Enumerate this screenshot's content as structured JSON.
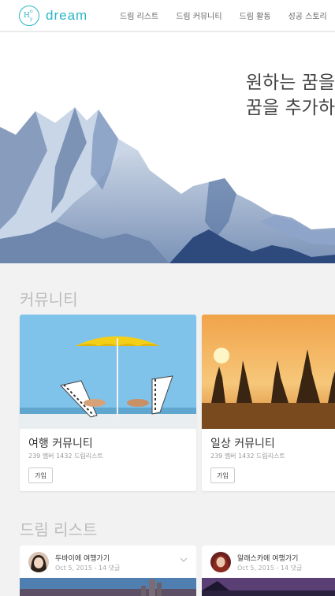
{
  "header": {
    "logo_text": "dream",
    "nav": [
      "드림 리스트",
      "드림 커뮤니티",
      "드림 활동",
      "성공 스토리"
    ]
  },
  "hero": {
    "line1": "원하는 꿈을",
    "line2": "꿈을 추가하"
  },
  "community": {
    "title": "커뮤니티",
    "cards": [
      {
        "title": "여행 커뮤니티",
        "meta": "239 멤버 1432 드림리스트",
        "button": "가입"
      },
      {
        "title": "일상 커뮤니티",
        "meta": "239 멤버 1432 드림리스트",
        "button": "가입"
      }
    ]
  },
  "dreamlist": {
    "title": "드림 리스트",
    "items": [
      {
        "title": "두바이에 여행가기",
        "meta": "Oct 5, 2015 - 14 댓글"
      },
      {
        "title": "알래스카에 여행가기",
        "meta": "Oct 5, 2015 - 14 댓글"
      }
    ]
  },
  "colors": {
    "accent": "#29b6c5"
  }
}
